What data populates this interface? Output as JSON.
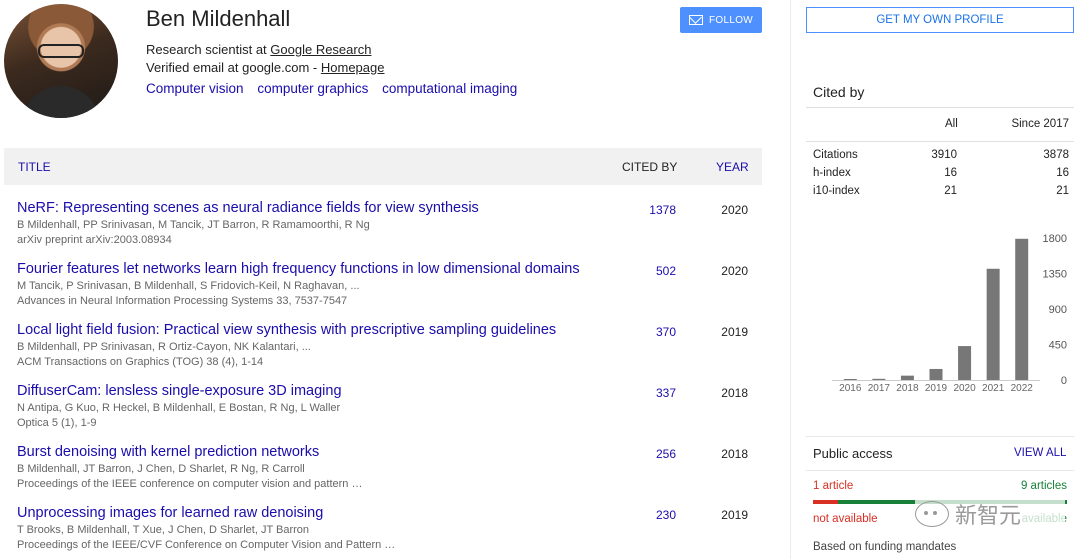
{
  "profile": {
    "name": "Ben Mildenhall",
    "affiliation_prefix": "Research scientist at ",
    "affiliation_link": "Google Research",
    "email_text": "Verified email at google.com - ",
    "homepage_link": "Homepage",
    "interests": [
      "Computer vision",
      "computer graphics",
      "computational imaging"
    ],
    "follow_label": "FOLLOW"
  },
  "table": {
    "header": {
      "title": "TITLE",
      "cited_by": "CITED BY",
      "year": "YEAR"
    },
    "rows": [
      {
        "title": "NeRF: Representing scenes as neural radiance fields for view synthesis",
        "authors": "B Mildenhall, PP Srinivasan, M Tancik, JT Barron, R Ramamoorthi, R Ng",
        "venue": "arXiv preprint arXiv:2003.08934",
        "cited": "1378",
        "year": "2020"
      },
      {
        "title": "Fourier features let networks learn high frequency functions in low dimensional domains",
        "authors": "M Tancik, P Srinivasan, B Mildenhall, S Fridovich-Keil, N Raghavan, ...",
        "venue": "Advances in Neural Information Processing Systems 33, 7537-7547",
        "cited": "502",
        "year": "2020"
      },
      {
        "title": "Local light field fusion: Practical view synthesis with prescriptive sampling guidelines",
        "authors": "B Mildenhall, PP Srinivasan, R Ortiz-Cayon, NK Kalantari, ...",
        "venue": "ACM Transactions on Graphics (TOG) 38 (4), 1-14",
        "cited": "370",
        "year": "2019"
      },
      {
        "title": "DiffuserCam: lensless single-exposure 3D imaging",
        "authors": "N Antipa, G Kuo, R Heckel, B Mildenhall, E Bostan, R Ng, L Waller",
        "venue": "Optica 5 (1), 1-9",
        "cited": "337",
        "year": "2018"
      },
      {
        "title": "Burst denoising with kernel prediction networks",
        "authors": "B Mildenhall, JT Barron, J Chen, D Sharlet, R Ng, R Carroll",
        "venue": "Proceedings of the IEEE conference on computer vision and pattern …",
        "cited": "256",
        "year": "2018"
      },
      {
        "title": "Unprocessing images for learned raw denoising",
        "authors": "T Brooks, B Mildenhall, T Xue, J Chen, D Sharlet, JT Barron",
        "venue": "Proceedings of the IEEE/CVF Conference on Computer Vision and Pattern …",
        "cited": "230",
        "year": "2019"
      }
    ]
  },
  "sidebar": {
    "get_profile_label": "GET MY OWN PROFILE",
    "cited_by_title": "Cited by",
    "col_all": "All",
    "col_since": "Since 2017",
    "stats": [
      {
        "label": "Citations",
        "all": "3910",
        "since": "3878"
      },
      {
        "label": "h-index",
        "all": "16",
        "since": "16"
      },
      {
        "label": "i10-index",
        "all": "21",
        "since": "21"
      }
    ],
    "public_access": {
      "title": "Public access",
      "view_all": "VIEW ALL",
      "left1": "1 article",
      "right1": "9 articles",
      "left2": "not available",
      "right2": "available",
      "available_fraction": 0.9,
      "note": "Based on funding mandates"
    },
    "watermark_text": "新智元"
  },
  "chart_data": {
    "type": "bar",
    "categories": [
      "2016",
      "2017",
      "2018",
      "2019",
      "2020",
      "2021",
      "2022"
    ],
    "values": [
      10,
      15,
      55,
      140,
      430,
      1410,
      1790
    ],
    "yticks": [
      "1800",
      "1350",
      "900",
      "450",
      "0"
    ],
    "ylim": [
      0,
      1800
    ],
    "bar_color": "#777777"
  }
}
